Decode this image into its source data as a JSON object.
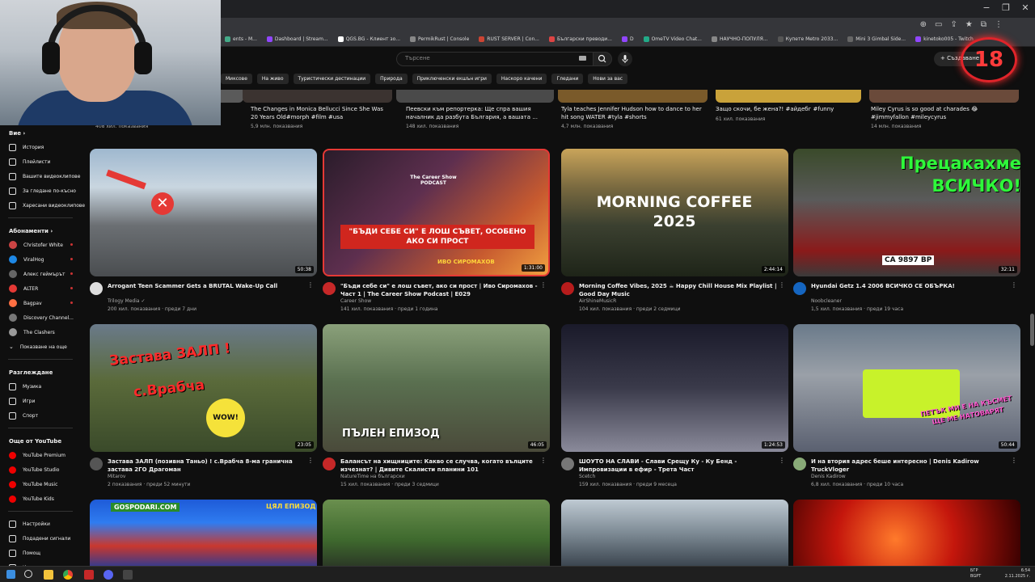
{
  "browser": {
    "controls": [
      "−",
      "❐",
      "✕"
    ],
    "bookmarks": [
      {
        "label": "ents - M...",
        "color": "#4a8"
      },
      {
        "label": "Dashboard | Stream...",
        "color": "#9146ff"
      },
      {
        "label": "QGS.BG - Клиент зо...",
        "color": "#fff"
      },
      {
        "label": "PermikRust | Console",
        "color": "#888"
      },
      {
        "label": "RUST SERVER | Con...",
        "color": "#c43"
      },
      {
        "label": "Български преводи...",
        "color": "#d44"
      },
      {
        "label": "D",
        "color": "#9146ff"
      },
      {
        "label": "OmeTV Video Chat...",
        "color": "#2a8"
      },
      {
        "label": "НАУЧНО-ПОПУЛЯ...",
        "color": "#888"
      },
      {
        "label": "Купете Metro 2033...",
        "color": "#555"
      },
      {
        "label": "Mini 3 Gimbal Side...",
        "color": "#666"
      },
      {
        "label": "kinetoko005 - Twitch",
        "color": "#9146ff"
      }
    ]
  },
  "header": {
    "search_placeholder": "Търсене",
    "create_label": "+ Създаване",
    "age_badge": "18"
  },
  "chips": [
    "Миксове",
    "На живо",
    "Туристически дестинации",
    "Природа",
    "Приключенски екшън игри",
    "Наскоро качени",
    "Гледани",
    "Нови за вас"
  ],
  "sidebar": {
    "you_label": "Вие  ›",
    "you_items": [
      "История",
      "Плейлисти",
      "Вашите видеоклипове",
      "За гледане по-късно",
      "Харесани видеоклипове"
    ],
    "subs_label": "Абонаменти  ›",
    "subscriptions": [
      {
        "name": "Christofer White",
        "color": "#c44",
        "dot": true
      },
      {
        "name": "ViralHog",
        "color": "#1e88e5",
        "dot": true
      },
      {
        "name": "Алекс геймърът",
        "color": "#666",
        "dot": true
      },
      {
        "name": "ALTER",
        "color": "#e53935",
        "dot": true
      },
      {
        "name": "Bagpav",
        "color": "#ff7043",
        "dot": true
      },
      {
        "name": "Discovery Channel...",
        "color": "#777",
        "dot": false
      },
      {
        "name": "The Clashers",
        "color": "#999",
        "dot": false
      }
    ],
    "show_more": "Показване на още",
    "explore_label": "Разглеждане",
    "explore_items": [
      "Музика",
      "Игри",
      "Спорт"
    ],
    "more_label": "Още от YouTube",
    "more_items": [
      "YouTube Premium",
      "YouTube Studio",
      "YouTube Music",
      "YouTube Kids"
    ],
    "settings_items": [
      "Настройки",
      "Подадени сигнали",
      "Помощ",
      "Изпращане на отзив"
    ]
  },
  "top_row": [
    {
      "title": "",
      "meta": "408 хил. показвания"
    },
    {
      "title": "The Changes in Monica Bellucci Since She Was 20 Years Old#morph #film #usa",
      "meta": "5,9 млн. показвания"
    },
    {
      "title": "Пеевски към репортерка: Ще спра вашия началник да разбута България, а вашата ...",
      "meta": "148 хил. показвания"
    },
    {
      "title": "Tyla teaches Jennifer Hudson how to dance to her hit song WATER #tyla #shorts",
      "meta": "4,7 млн. показвания"
    },
    {
      "title": "Защо скочи, бе жена?! #айдебг #funny",
      "meta": "61 хил. показвания"
    },
    {
      "title": "Miley Cyrus is so good at charades 😂 #jimmyfallon #mileycyrus",
      "meta": "14 млн. показвания"
    }
  ],
  "videos": [
    {
      "title": "Arrogant Teen Scammer Gets a BRUTAL Wake-Up Call",
      "channel": "Trilogy Media ✓",
      "meta": "200 хил. показвания · преди 7 дни",
      "duration": "50:38",
      "avatar": "#ddd"
    },
    {
      "title": "\"Бъди себе си\" е лош съвет, ако си прост | Иво Сиромахов - Част 1 | The Career Show Podcast | E029",
      "channel": "Career Show",
      "meta": "141 хил. показвания · преди 1 година",
      "duration": "1:31:00",
      "avatar": "#c62828",
      "overlay_main": "\"БЪДИ СЕБЕ СИ\" Е ЛОШ СЪВЕТ, ОСОБЕНО АКО СИ ПРОСТ",
      "overlay_name": "ИВО СИРОМАХОВ",
      "overlay_logo": "The Career Show PODCAST"
    },
    {
      "title": "Morning Coffee Vibes, 2025 ☕ Happy Chill House Mix Playlist | Good Day Music",
      "channel": "AirShineMusicR",
      "meta": "104 хил. показвания · преди 2 седмици",
      "duration": "2:44:14",
      "avatar": "#b71c1c",
      "overlay_main": "MORNING COFFEE 2025"
    },
    {
      "title": "Hyundai Getz 1.4 2006  ВСИЧКО СЕ ОБЪРКА!",
      "channel": "Noobcleaner",
      "meta": "1,5 хил. показвания · преди 19 часа",
      "duration": "32:11",
      "avatar": "#1565c0",
      "overlay_main": "Прецакахме ВСИЧКО!",
      "overlay_plate": "CA 9897 BP"
    },
    {
      "title": "Застава ЗАЛП (позивна Таньо) ! с.Врабча 8-ма гранична застава 2ГО Драгоман",
      "channel": "Mitarov",
      "meta": "2 показвания · преди 52 минути",
      "duration": "23:05",
      "avatar": "#555",
      "overlay_main": "Застава ЗАЛП !",
      "overlay_sub": "с.Врабча",
      "overlay_wow": "WOW!"
    },
    {
      "title": "Балансът на хищниците: Какво се случва, когато вълците изчезнат? | Дивите Скалисти планини 101",
      "channel": "NatureTime на български",
      "meta": "15 хил. показвания · преди 3 седмици",
      "duration": "46:05",
      "avatar": "#c62828",
      "overlay_main": "ПЪЛЕН ЕПИЗОД"
    },
    {
      "title": "ШОУТО НА СЛАВИ - Слави Срещу Ку - Ку Бенд - Импровизации в ефир - Трета Част",
      "channel": "Scetch",
      "meta": "159 хил. показвания · преди 9 месеца",
      "duration": "1:24:53",
      "avatar": "#777"
    },
    {
      "title": "И на втория адрес беше интересно | Denis Kadirow TruckVloger",
      "channel": "Denis Kadirow",
      "meta": "6,8 хил. показвания · преди 10 часа",
      "duration": "50:44",
      "avatar": "#8a7",
      "overlay_main": "ПЕТЪК МИ Е НА КЪСМЕТ ЩЕ МЕ НАТОВАРЯТ"
    }
  ],
  "bottom_row": [
    {
      "overlay_main": "GOSPODARI.COM",
      "overlay_side": "ЦЯЛ ЕПИЗОД"
    },
    {
      "overlay_main": ""
    },
    {
      "overlay_main": ""
    },
    {
      "overlay_main": ""
    }
  ],
  "taskbar": {
    "lang": "БГР",
    "lang2": "BGPT",
    "time": "6:54",
    "date": "2.11.2025 г."
  },
  "colors": {
    "bg": "#0f0f0f",
    "accent": "#ff0000",
    "card_border": "#e53935"
  }
}
